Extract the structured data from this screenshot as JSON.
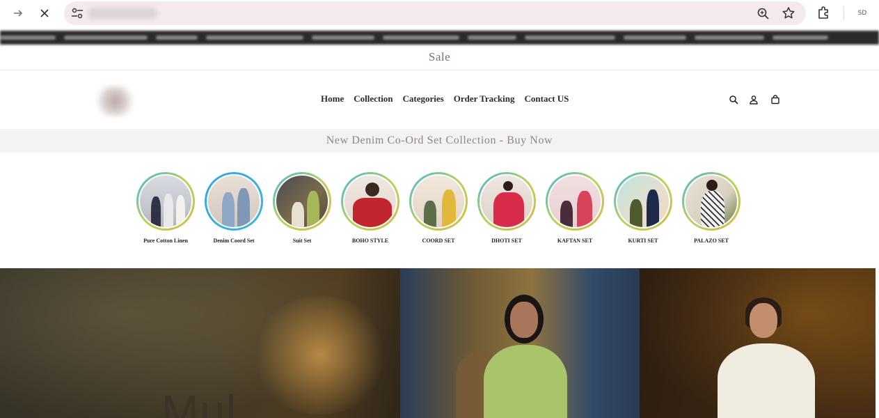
{
  "browser": {
    "icons": [
      "forward-arrow-icon",
      "close-icon",
      "site-settings-icon",
      "zoom-icon",
      "star-icon",
      "extensions-icon",
      "profile-avatar"
    ],
    "profile_initials": "SD"
  },
  "sale_bar": {
    "text": "Sale"
  },
  "header": {
    "nav": [
      "Home",
      "Collection",
      "Categories",
      "Order Tracking",
      "Contact US"
    ],
    "icons": [
      "search-icon",
      "account-icon",
      "cart-icon"
    ]
  },
  "announcement": {
    "text": "New Denim Co-Ord Set Collection - Buy Now"
  },
  "categories": [
    {
      "label": "Pure Cotton Linen"
    },
    {
      "label": "Denim Coord Set"
    },
    {
      "label": "Suit Set"
    },
    {
      "label": "BOHO STYLE"
    },
    {
      "label": "COORD SET"
    },
    {
      "label": "DHOTI SET"
    },
    {
      "label": "KAFTAN SET"
    },
    {
      "label": "KURTI SET"
    },
    {
      "label": "PALAZO SET"
    }
  ],
  "hero": {
    "partial_text": "Mul"
  },
  "colors": {
    "sale_text": "#8a6a6c",
    "announcement_bg": "#f3f3f3",
    "announcement_text": "#8f8585",
    "omnibox_bg": "#f4e9ec"
  }
}
